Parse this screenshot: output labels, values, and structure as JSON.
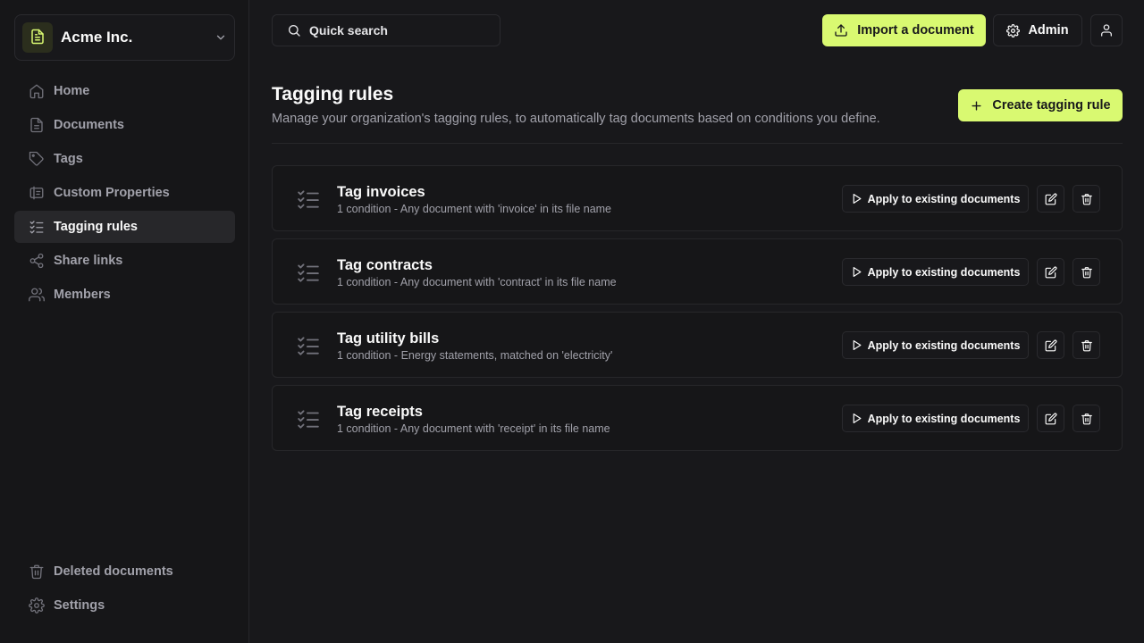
{
  "org": {
    "name": "Acme Inc."
  },
  "nav": {
    "items": [
      {
        "label": "Home",
        "icon": "home-icon"
      },
      {
        "label": "Documents",
        "icon": "file-icon"
      },
      {
        "label": "Tags",
        "icon": "tag-icon"
      },
      {
        "label": "Custom Properties",
        "icon": "properties-icon"
      },
      {
        "label": "Tagging rules",
        "icon": "list-check-icon",
        "active": true
      },
      {
        "label": "Share links",
        "icon": "share-icon"
      },
      {
        "label": "Members",
        "icon": "users-icon"
      }
    ],
    "bottom": [
      {
        "label": "Deleted documents",
        "icon": "trash-icon"
      },
      {
        "label": "Settings",
        "icon": "gear-icon"
      }
    ]
  },
  "topbar": {
    "search_label": "Quick search",
    "import_label": "Import a document",
    "admin_label": "Admin"
  },
  "page": {
    "title": "Tagging rules",
    "description": "Manage your organization's tagging rules, to automatically tag documents based on conditions you define.",
    "create_label": "Create tagging rule"
  },
  "rules": [
    {
      "name": "Tag invoices",
      "description": "1 condition - Any document with 'invoice' in its file name",
      "apply_label": "Apply to existing documents"
    },
    {
      "name": "Tag contracts",
      "description": "1 condition - Any document with 'contract' in its file name",
      "apply_label": "Apply to existing documents"
    },
    {
      "name": "Tag utility bills",
      "description": "1 condition - Energy statements, matched on 'electricity'",
      "apply_label": "Apply to existing documents"
    },
    {
      "name": "Tag receipts",
      "description": "1 condition - Any document with 'receipt' in its file name",
      "apply_label": "Apply to existing documents"
    }
  ],
  "colors": {
    "accent": "#d9f971",
    "background": "#18181b",
    "border": "#27272a",
    "muted_text": "#a1a1aa"
  }
}
